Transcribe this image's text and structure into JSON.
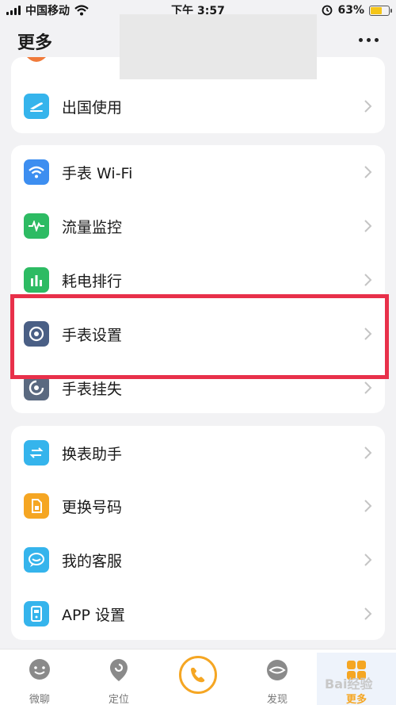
{
  "status": {
    "carrier": "中国移动",
    "time": "下午 3:57",
    "battery": "63%",
    "battery_level": 0.63
  },
  "header": {
    "title": "更多"
  },
  "cards": {
    "abroad": {
      "label": "出国使用"
    },
    "watch": {
      "items": [
        {
          "label": "手表 Wi-Fi",
          "icon": "wifi-icon",
          "color": "#3d8ef0"
        },
        {
          "label": "流量监控",
          "icon": "pulse-icon",
          "color": "#2dbb63"
        },
        {
          "label": "耗电排行",
          "icon": "bar-chart-icon",
          "color": "#2dbb63"
        },
        {
          "label": "手表设置",
          "icon": "watch-settings-icon",
          "color": "#4a5f85"
        },
        {
          "label": "手表挂失",
          "icon": "lost-icon",
          "color": "#5a6980"
        }
      ]
    },
    "other": {
      "items": [
        {
          "label": "换表助手",
          "icon": "swap-icon",
          "color": "#35b4ec"
        },
        {
          "label": "更换号码",
          "icon": "sim-icon",
          "color": "#f5a623"
        },
        {
          "label": "我的客服",
          "icon": "service-icon",
          "color": "#35b4ec"
        },
        {
          "label": "APP 设置",
          "icon": "app-settings-icon",
          "color": "#35b4ec"
        }
      ]
    }
  },
  "nav": {
    "items": [
      {
        "label": "微聊",
        "icon": "chat-icon"
      },
      {
        "label": "定位",
        "icon": "location-icon"
      },
      {
        "label": "",
        "icon": "phone-icon"
      },
      {
        "label": "发现",
        "icon": "discover-icon"
      },
      {
        "label": "更多",
        "icon": "more-icon"
      }
    ],
    "accent": "#f5a623"
  },
  "watermark": "Bai经验"
}
